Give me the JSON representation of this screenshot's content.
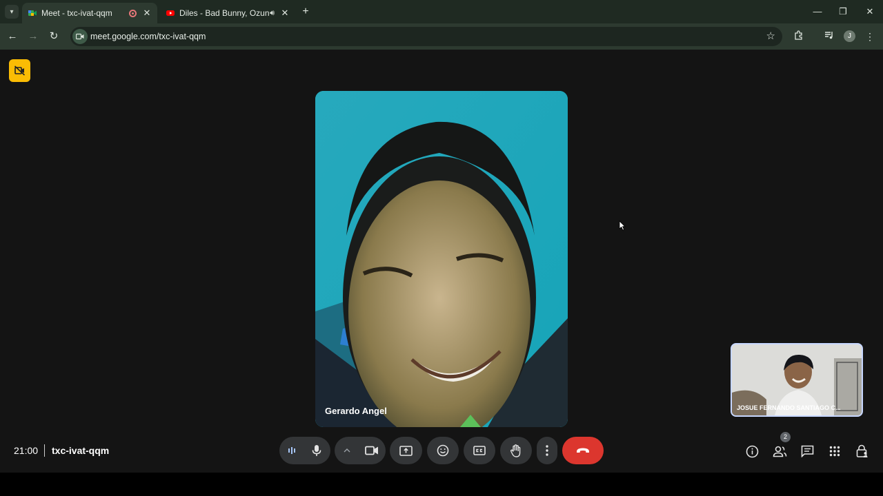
{
  "browser": {
    "tabs": [
      {
        "title": "Meet - txc-ivat-qqm",
        "active": true
      },
      {
        "title": "Diles - Bad Bunny, Ozuna, F",
        "active": false
      }
    ],
    "url": "meet.google.com/txc-ivat-qqm",
    "profile_initial": "J"
  },
  "meet": {
    "main_participant": "Gerardo Angel",
    "self_participant": "JOSUE FERNANDO SANTIAGO C...",
    "time": "21:00",
    "meeting_code": "txc-ivat-qqm",
    "people_count": "2"
  },
  "colors": {
    "end_call": "#dc362e",
    "badge": "#fbbc04",
    "background": "#141414"
  }
}
